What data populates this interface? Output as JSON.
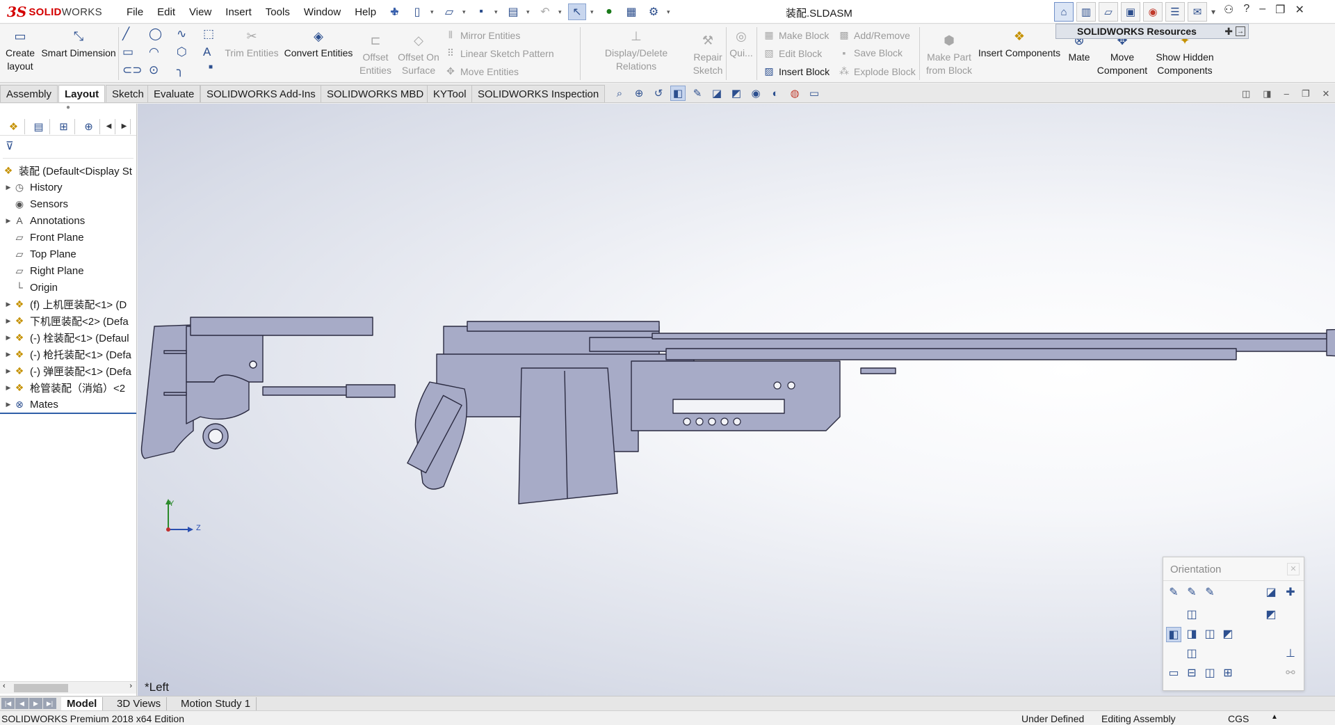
{
  "app": {
    "logo_prefix": "3S",
    "logo_brand": "SOLID",
    "logo_brand2": "WORKS",
    "document_title": "装配.SLDASM"
  },
  "menu": [
    "File",
    "Edit",
    "View",
    "Insert",
    "Tools",
    "Window",
    "Help"
  ],
  "resources_popup": "SOLIDWORKS Resources",
  "command_manager": {
    "create_layout": "Create layout",
    "smart_dimension": "Smart Dimension",
    "trim_entities": "Trim Entities",
    "convert_entities": "Convert Entities",
    "offset_entities": "Offset Entities",
    "offset_on_surface": "Offset On Surface",
    "mirror_entities": "Mirror Entities",
    "linear_sketch_pattern": "Linear Sketch Pattern",
    "move_entities": "Move Entities",
    "display_delete_relations": "Display/Delete Relations",
    "repair_sketch": "Repair Sketch",
    "quick_snaps": "Qui...",
    "make_block": "Make Block",
    "edit_block": "Edit Block",
    "insert_block": "Insert Block",
    "add_remove": "Add/Remove",
    "save_block": "Save Block",
    "explode_block": "Explode Block",
    "make_part_from_block": "Make Part from Block",
    "insert_components": "Insert Components",
    "mate": "Mate",
    "move_component": "Move Component",
    "show_hidden_components": "Show Hidden Components"
  },
  "tabs": [
    "Assembly",
    "Layout",
    "Sketch",
    "Evaluate",
    "SOLIDWORKS Add-Ins",
    "SOLIDWORKS MBD",
    "KYTool",
    "SOLIDWORKS Inspection"
  ],
  "active_tab": "Layout",
  "feature_tree": {
    "root": "装配  (Default<Display St",
    "items": [
      {
        "label": "History",
        "icon": "history-icon"
      },
      {
        "label": "Sensors",
        "icon": "sensors-icon"
      },
      {
        "label": "Annotations",
        "icon": "annotations-icon"
      },
      {
        "label": "Front Plane",
        "icon": "plane-icon"
      },
      {
        "label": "Top Plane",
        "icon": "plane-icon"
      },
      {
        "label": "Right Plane",
        "icon": "plane-icon"
      },
      {
        "label": "Origin",
        "icon": "origin-icon"
      },
      {
        "label": "(f) 上机匣装配<1> (D",
        "icon": "subassembly-icon"
      },
      {
        "label": "下机匣装配<2> (Defa",
        "icon": "subassembly-icon"
      },
      {
        "label": "(-) 栓装配<1> (Defaul",
        "icon": "subassembly-icon"
      },
      {
        "label": "(-) 枪托装配<1> (Defa",
        "icon": "subassembly-icon"
      },
      {
        "label": "(-) 弹匣装配<1> (Defa",
        "icon": "subassembly-icon"
      },
      {
        "label": "枪管装配（消焰）<2",
        "icon": "subassembly-icon"
      },
      {
        "label": "Mates",
        "icon": "mates-icon"
      }
    ]
  },
  "viewport": {
    "view_name": "*Left",
    "triad_y": "Y",
    "triad_z": "Z"
  },
  "orientation_panel": {
    "title": "Orientation"
  },
  "bottom_tabs": [
    "Model",
    "3D Views",
    "Motion Study 1"
  ],
  "active_bottom_tab": "Model",
  "status": {
    "edition": "SOLIDWORKS Premium 2018 x64 Edition",
    "definition": "Under Defined",
    "mode": "Editing Assembly",
    "units": "CGS"
  },
  "colors": {
    "brand": "#d40000",
    "accent": "#2f5fa8",
    "model_fill": "#a7abc7",
    "model_stroke": "#2a2a40"
  }
}
